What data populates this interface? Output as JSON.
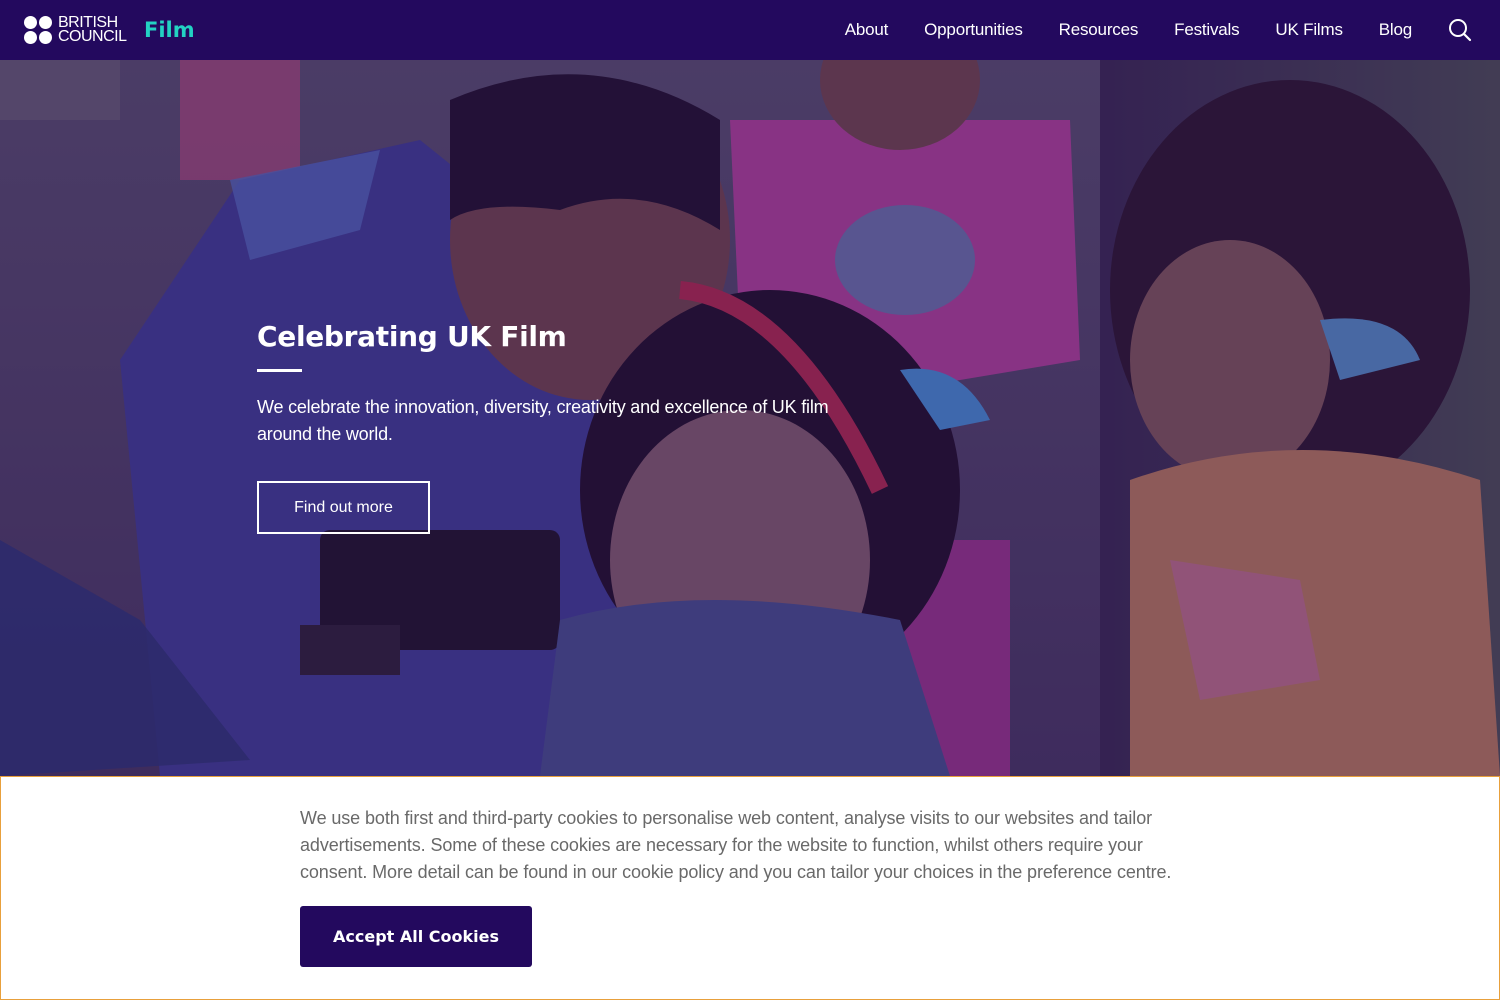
{
  "header": {
    "logo_line1": "BRITISH",
    "logo_line2": "COUNCIL",
    "site_name": "Film",
    "nav": [
      "About",
      "Opportunities",
      "Resources",
      "Festivals",
      "UK Films",
      "Blog"
    ],
    "search_icon": "search-icon",
    "background_color": "#23095e",
    "accent_color": "#23d2c3"
  },
  "hero": {
    "title": "Celebrating UK Film",
    "description": "We celebrate the innovation, diversity, creativity and excellence of UK film around the world.",
    "button_label": "Find out more"
  },
  "cookie_banner": {
    "text": "We use both first and third-party cookies to personalise web content, analyse visits to our websites and tailor advertisements. Some of these cookies are necessary for the website to function, whilst others require your consent. More detail can be found in our cookie policy and you can tailor your choices in the preference centre.",
    "accept_label": "Accept All Cookies",
    "border_color": "#e8a03c"
  }
}
